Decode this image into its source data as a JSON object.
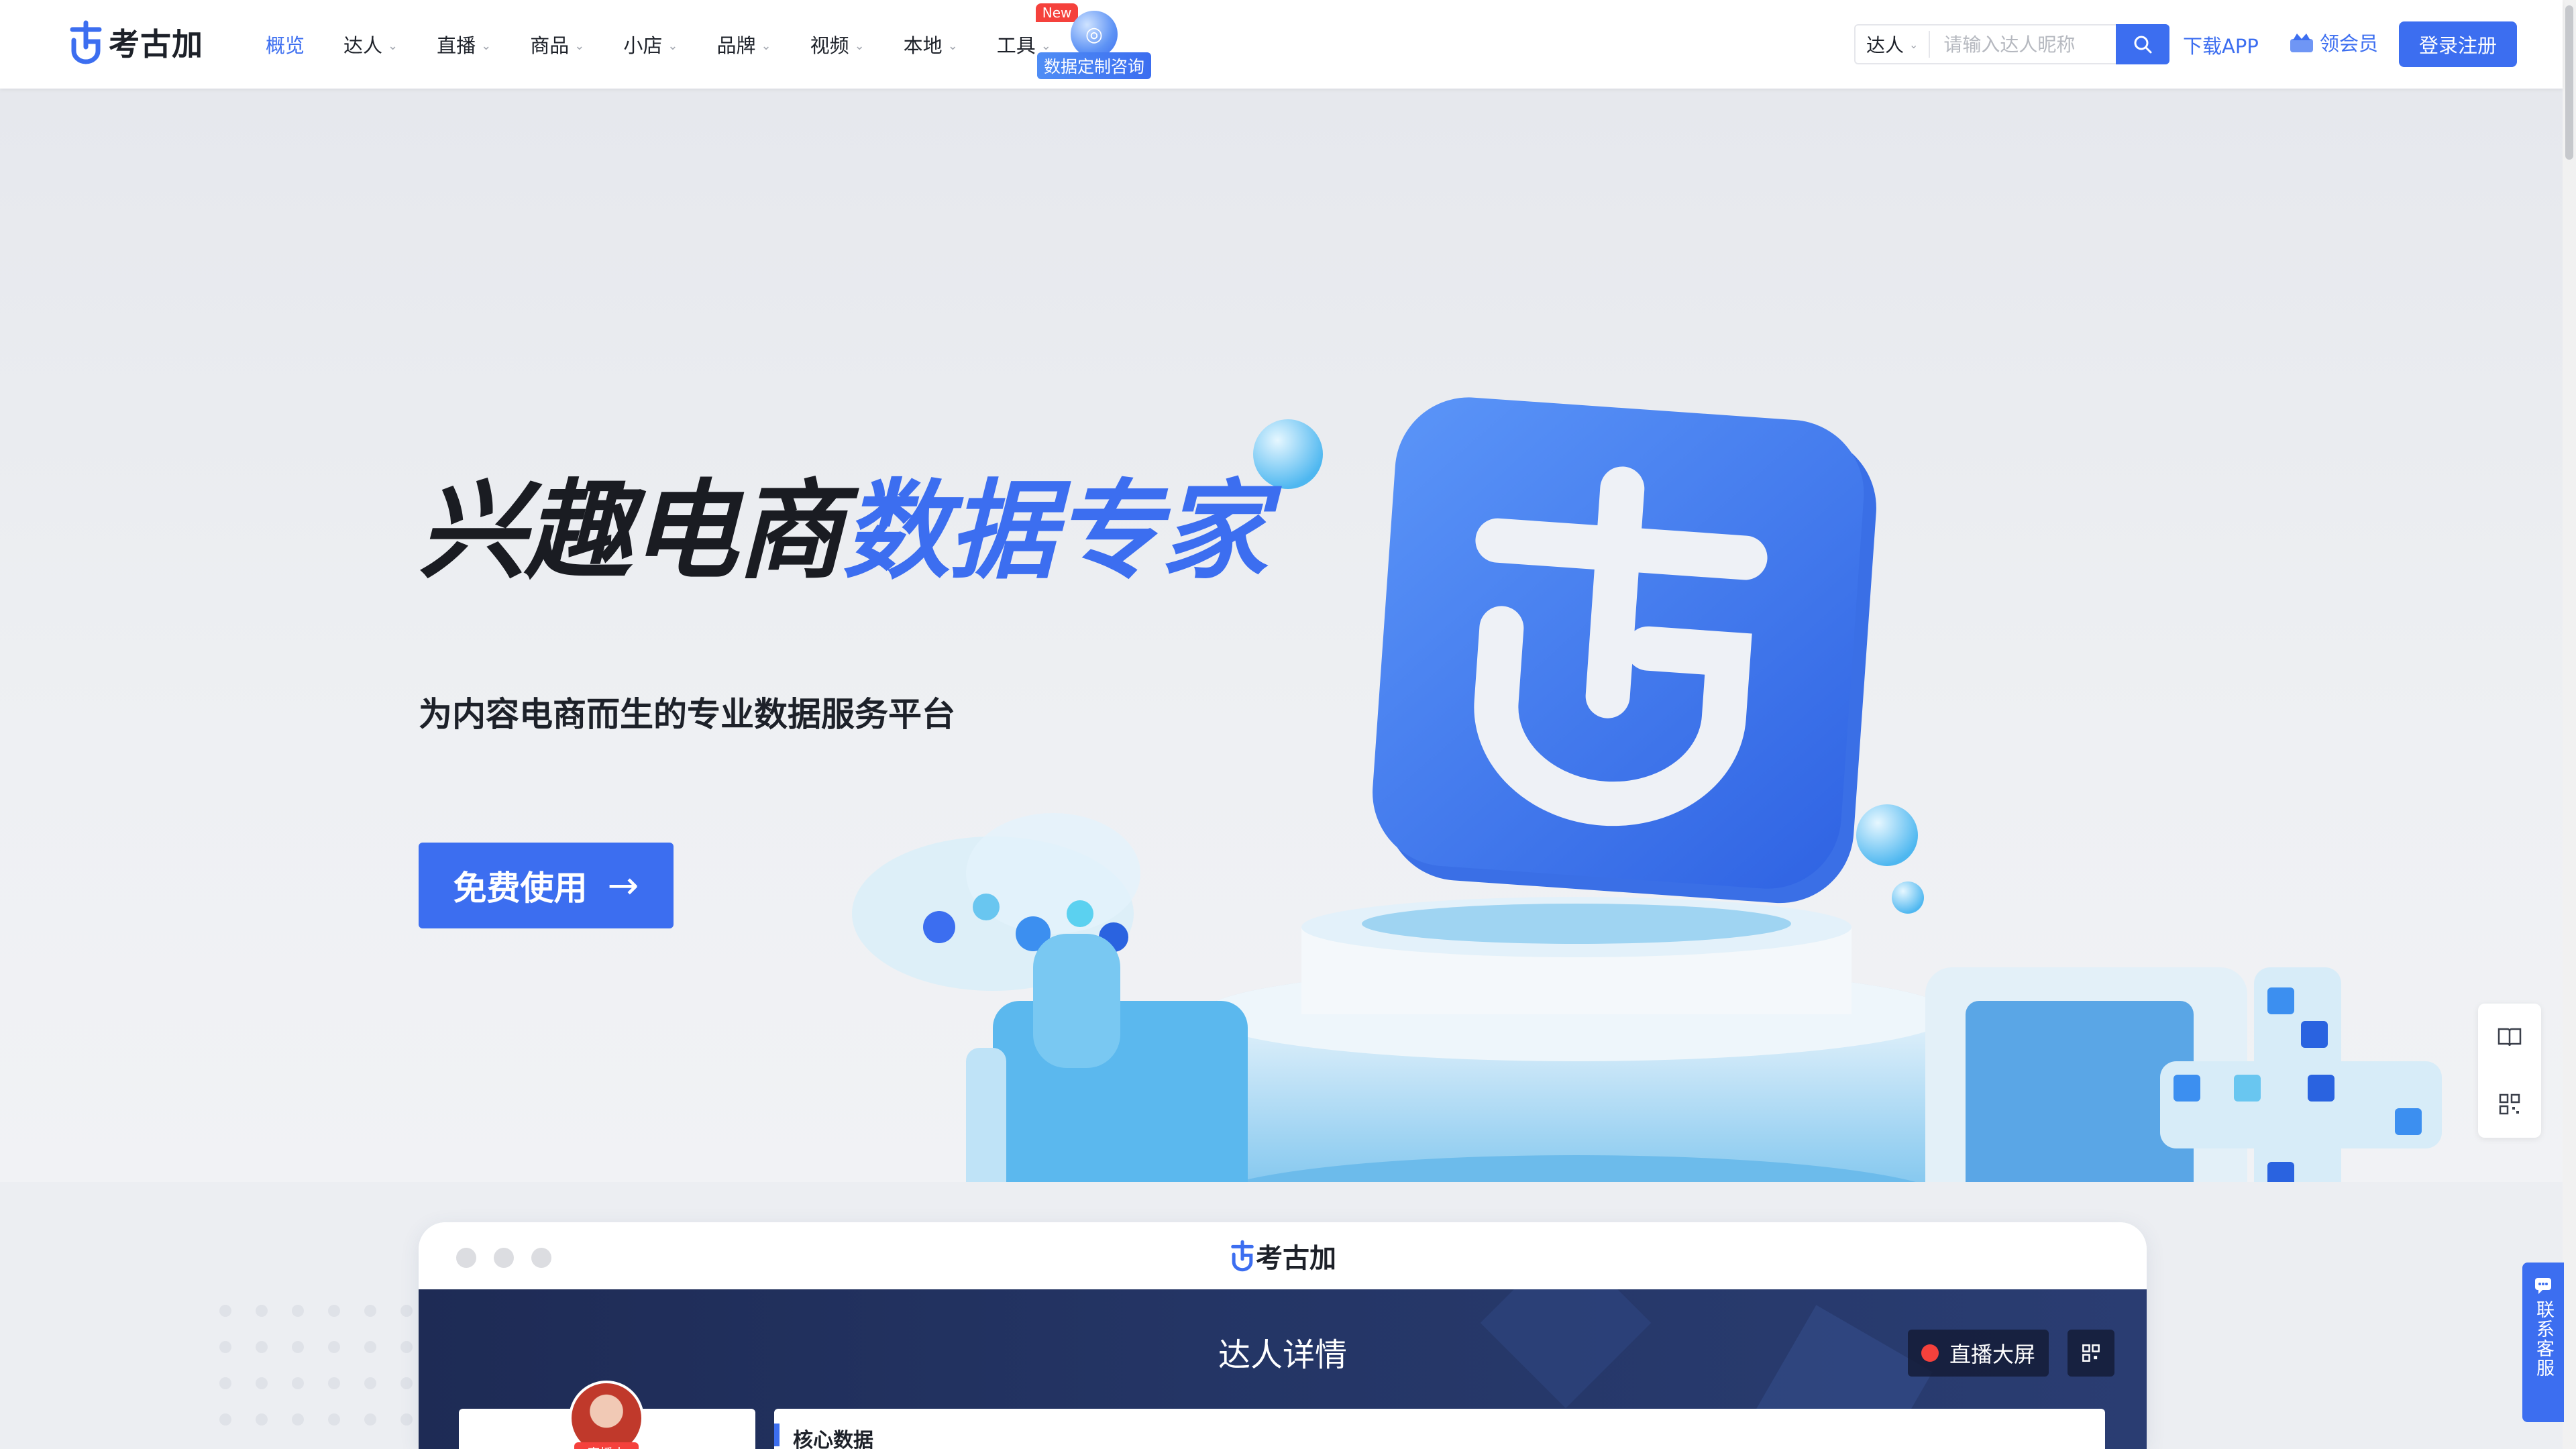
{
  "brand": {
    "name": "考古加",
    "accent": "#3c6ef0"
  },
  "nav": {
    "items": [
      {
        "label": "概览",
        "active": true,
        "has_menu": false
      },
      {
        "label": "达人",
        "has_menu": true
      },
      {
        "label": "直播",
        "has_menu": true
      },
      {
        "label": "商品",
        "has_menu": true
      },
      {
        "label": "小店",
        "has_menu": true
      },
      {
        "label": "品牌",
        "has_menu": true
      },
      {
        "label": "视频",
        "has_menu": true
      },
      {
        "label": "本地",
        "has_menu": true
      },
      {
        "label": "工具",
        "has_menu": true,
        "badge": "New"
      }
    ],
    "consult_label": "数据定制咨询"
  },
  "search": {
    "type": "达人",
    "placeholder": "请输入达人昵称"
  },
  "header_actions": {
    "download": "下载APP",
    "vip": "领会员",
    "login": "登录注册"
  },
  "hero": {
    "title_dark": "兴趣电商",
    "title_blue": "数据专家",
    "subtitle": "为内容电商而生的专业数据服务平台",
    "cta": "免费使用"
  },
  "side": {
    "contact": "联系客服"
  },
  "preview": {
    "logo_text": "考古加",
    "title": "达人详情",
    "live_screen": "直播大屏",
    "live_badge": "直播中",
    "core_label": "核心数据"
  }
}
